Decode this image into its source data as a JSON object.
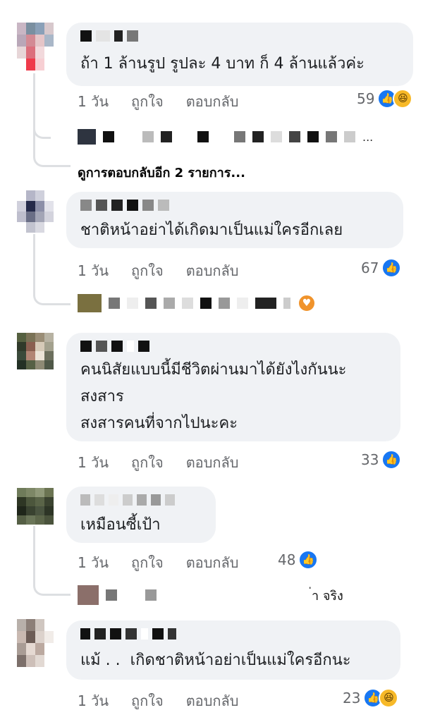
{
  "comments": [
    {
      "text_lines": [
        "ถ้า 1 ล้านรูป รูปละ 4 บาท ก็ 4 ล้านแล้วค่ะ"
      ],
      "time": "1 วัน",
      "like_label": "ถูกใจ",
      "reply_label": "ตอบกลับ",
      "reaction_count": "59",
      "reactions": [
        "like-icon",
        "haha-icon"
      ]
    },
    {
      "text_lines": [
        "ชาติหน้าอย่าได้เกิดมาเป็นแม่ใครอีกเลย"
      ],
      "time": "1 วัน",
      "like_label": "ถูกใจ",
      "reply_label": "ตอบกลับ",
      "reaction_count": "67",
      "reactions": [
        "like-icon"
      ]
    },
    {
      "text_lines": [
        "คนนิสัยแบบนี้มีชีวิตผ่านมาได้ยังไงกันนะ",
        "สงสาร",
        "สงสารคนที่จากไปนะคะ"
      ],
      "time": "1 วัน",
      "like_label": "ถูกใจ",
      "reply_label": "ตอบกลับ",
      "reaction_count": "33",
      "reactions": [
        "like-icon"
      ]
    },
    {
      "text_lines": [
        "เหมือนซี้เป้า"
      ],
      "time": "1 วัน",
      "like_label": "ถูกใจ",
      "reply_label": "ตอบกลับ",
      "reaction_count": "48",
      "reactions": [
        "like-icon"
      ]
    },
    {
      "text_lines": [
        "แม้ . .  เกิดชาติหน้าอย่าเป็นแม่ใครอีกนะ"
      ],
      "time": "1 วัน",
      "like_label": "ถูกใจ",
      "reply_label": "ตอบกลับ",
      "reaction_count": "23",
      "reactions": [
        "like-icon",
        "haha-icon"
      ]
    }
  ],
  "replies": {
    "r1_tail": "...",
    "more_replies": "ดูการตอบกลับอีก 2 รายการ...",
    "r4_tail": "่า จริง"
  },
  "colors": {
    "like": "#1877f2",
    "haha": "#f7b928",
    "love": "#f0932b",
    "bubble": "#f0f2f5",
    "meta": "#65676b"
  }
}
